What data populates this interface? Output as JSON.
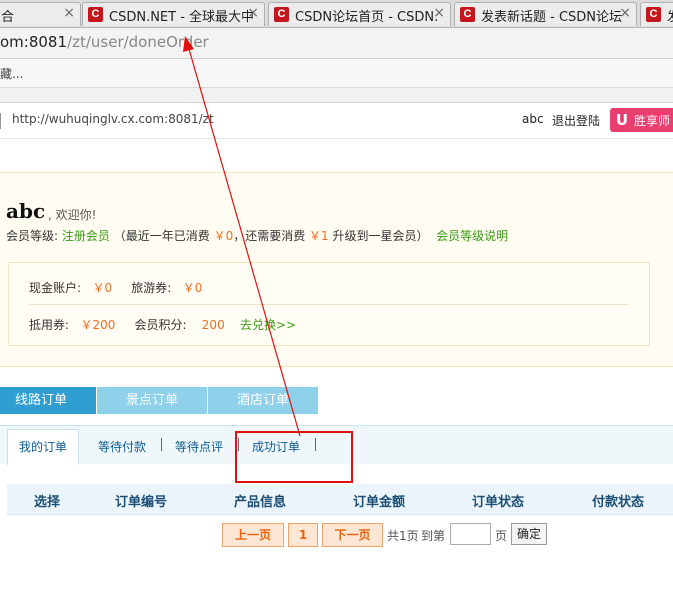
{
  "browser": {
    "tabs": [
      {
        "label": "合",
        "close": "×"
      },
      {
        "label": "CSDN.NET - 全球最大中",
        "close": "×"
      },
      {
        "label": "CSDN论坛首页 - CSDN.",
        "close": "×"
      },
      {
        "label": "发表新话题 - CSDN论坛",
        "close": "×"
      },
      {
        "label": "发",
        "close": ""
      }
    ],
    "favicon_glyph": "C",
    "address_host": "om:8081",
    "address_path": "/zt/user/doneOrder",
    "bookmark_text": "藏..."
  },
  "site": {
    "url": "http://wuhuqinglv.cx.com:8081/zt",
    "username": "abc",
    "logout": "退出登陆",
    "promo_icon": "U",
    "promo_text": "胜享师"
  },
  "member": {
    "name": "abc",
    "welcome": ", 欢迎你!",
    "level_label": "会员等级:",
    "level_value": "注册会员",
    "level_text1": "（最近一年已消费",
    "spent": "￥0",
    "level_text2": "，还需要消费",
    "need": "￥1",
    "level_text3": "升级到一星会员）",
    "level_help": "会员等级说明",
    "cash_label": "现金账户:",
    "cash_value": "￥0",
    "travel_label": "旅游券:",
    "travel_value": "￥0",
    "voucher_label": "抵用券:",
    "voucher_value": "￥200",
    "points_label": "会员积分:",
    "points_value": "200",
    "redeem": "去兑换>>"
  },
  "order_types": [
    {
      "label": "线路订单",
      "active": true
    },
    {
      "label": "景点订单",
      "active": false
    },
    {
      "label": "酒店订单",
      "active": false
    }
  ],
  "status_tabs": [
    {
      "label": "我的订单"
    },
    {
      "label": "等待付款"
    },
    {
      "label": "等待点评"
    },
    {
      "label": "成功订单"
    }
  ],
  "table_headers": [
    "选择",
    "订单编号",
    "产品信息",
    "订单金额",
    "订单状态",
    "付款状态"
  ],
  "pager": {
    "prev": "上一页",
    "page": "1",
    "next": "下一页",
    "total": "共1页",
    "goto": "到第",
    "unit": "页",
    "confirm": "确定"
  },
  "colors": {
    "annotation": "#e01010",
    "active_tab": "#2e9fd0",
    "inactive_tab": "#8fd0ea",
    "price": "#f0701f",
    "link_green": "#3c9a16"
  }
}
